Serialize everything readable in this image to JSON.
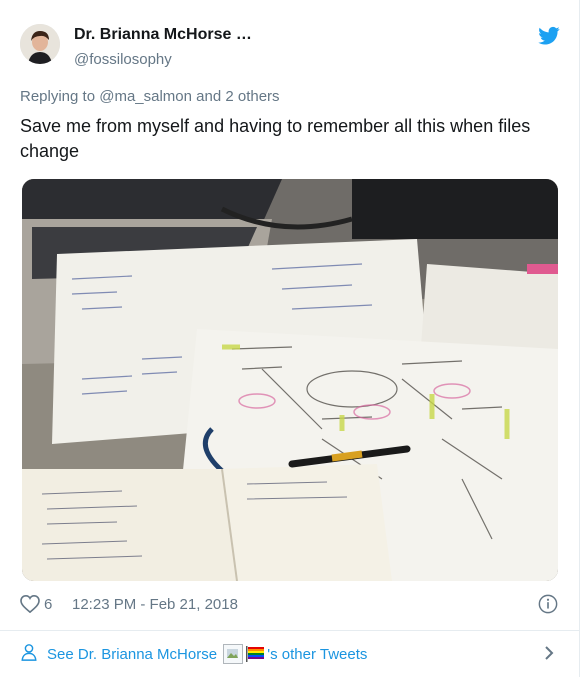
{
  "tweet": {
    "author_name": "Dr. Brianna McHorse …",
    "author_handle": "@fossilosophy",
    "reply_prefix": "Replying to",
    "reply_user": "@ma_salmon",
    "reply_suffix": "and 2 others",
    "text": "Save me from myself and having to remember all this when files change",
    "likes": "6",
    "timestamp": "12:23 PM - Feb 21, 2018",
    "image_description": "Desk with laptop, printed flowcharts, handwritten notebook and a pen",
    "colors": {
      "link": "#1b95e0",
      "muted": "#657786",
      "text": "#14171a",
      "divider": "#e6ecf0"
    }
  },
  "footer": {
    "see_prefix": "See Dr. Brianna McHorse",
    "see_suffix": "'s other Tweets"
  },
  "icons": [
    "avatar",
    "twitter-bird-icon",
    "heart-icon",
    "info-icon",
    "person-icon",
    "broken-image-icon",
    "rainbow-flag-icon",
    "chevron-right-icon"
  ]
}
